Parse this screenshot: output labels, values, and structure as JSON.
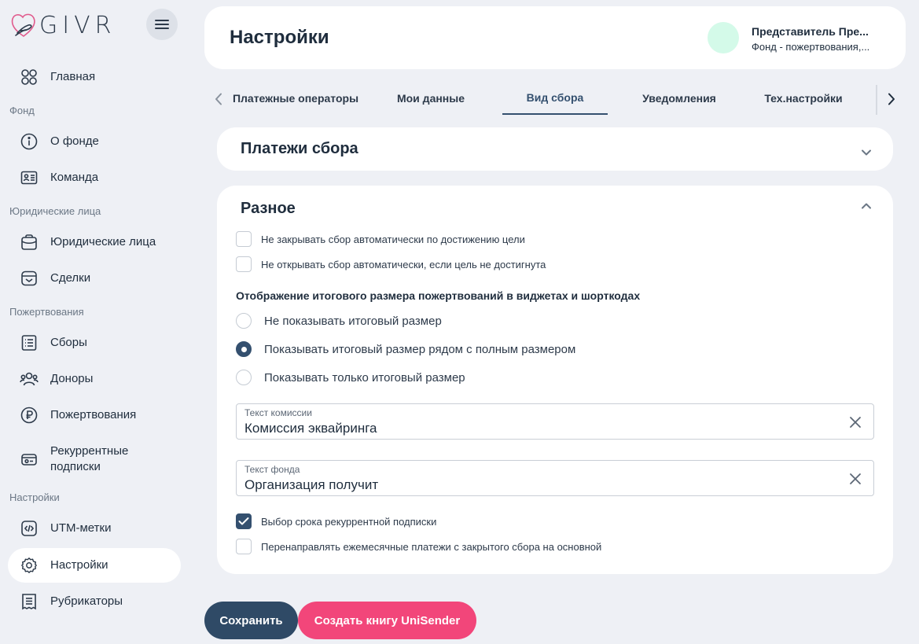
{
  "app": {
    "logo_text": "GIVR"
  },
  "sidebar": {
    "items": [
      {
        "label": "Главная",
        "icon": "grid-circles-icon"
      },
      {
        "section": "Фонд"
      },
      {
        "label": "О фонде",
        "icon": "info-icon"
      },
      {
        "label": "Команда",
        "icon": "id-card-icon"
      },
      {
        "section": "Юридические лица"
      },
      {
        "label": "Юридические лица",
        "icon": "briefcase-icon"
      },
      {
        "label": "Сделки",
        "icon": "deal-box-icon"
      },
      {
        "section": "Пожертвования"
      },
      {
        "label": "Сборы",
        "icon": "list-icon"
      },
      {
        "label": "Доноры",
        "icon": "people-icon"
      },
      {
        "label": "Пожертвования",
        "icon": "ruble-icon"
      },
      {
        "label": "Рекуррентные подписки",
        "icon": "recurring-card-icon"
      },
      {
        "section": "Настройки"
      },
      {
        "label": "UTM-метки",
        "icon": "code-icon"
      },
      {
        "label": "Настройки",
        "icon": "gear-icon",
        "active": true
      },
      {
        "label": "Рубрикаторы",
        "icon": "receipt-icon"
      }
    ]
  },
  "header": {
    "title": "Настройки",
    "user_name": "Представитель Пре...",
    "user_org": "Фонд - пожертвования,..."
  },
  "tabs": [
    {
      "label": "Платежные операторы"
    },
    {
      "label": "Мои данные"
    },
    {
      "label": "Вид сбора",
      "active": true
    },
    {
      "label": "Уведомления"
    },
    {
      "label": "Тех.настройки"
    }
  ],
  "payments_card": {
    "title": "Платежи сбора",
    "expanded": false
  },
  "misc_card": {
    "title": "Разное",
    "expanded": true,
    "checkboxes_top": [
      {
        "label": "Не закрывать сбор автоматически по достижению цели",
        "checked": false
      },
      {
        "label": "Не открывать сбор автоматически, если цель не достигнута",
        "checked": false
      }
    ],
    "display_section_label": "Отображение итогового размера пожертвований в виджетах и шорткодах",
    "radio_options": [
      {
        "label": "Не показывать итоговый размер",
        "checked": false
      },
      {
        "label": "Показывать итоговый размер рядом с полным размером",
        "checked": true
      },
      {
        "label": "Показывать только итоговый размер",
        "checked": false
      }
    ],
    "commission_field": {
      "label": "Текст комиссии",
      "value": "Комиссия эквайринга"
    },
    "fund_field": {
      "label": "Текст фонда",
      "value": "Организация получит"
    },
    "checkboxes_bottom": [
      {
        "label": "Выбор срока рекуррентной подписки",
        "checked": true
      },
      {
        "label": "Перенаправлять ежемесячные платежи с закрытого сбора на основной",
        "checked": false
      }
    ]
  },
  "buttons": {
    "save_label": "Сохранить",
    "unisender_label": "Создать книгу UniSender"
  },
  "colors": {
    "primary": "#2f4a66",
    "accent": "#f2467a",
    "background": "#eef0f5",
    "avatar": "#d4fae9"
  }
}
